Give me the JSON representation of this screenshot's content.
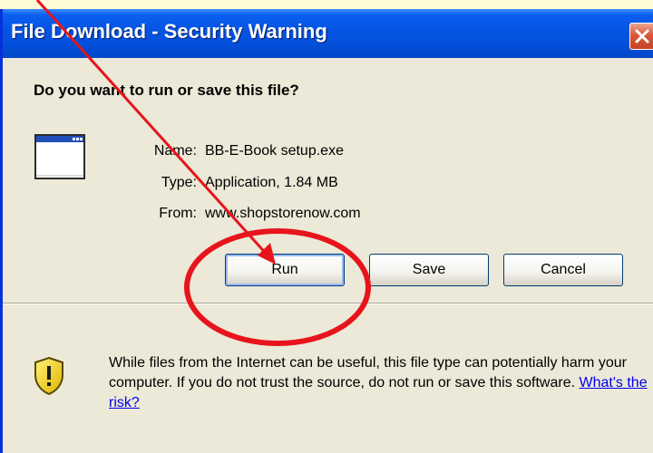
{
  "dialog": {
    "title": "File Download - Security Warning",
    "question": "Do you want to run or save this file?"
  },
  "file": {
    "name_label": "Name:",
    "name_value": "BB-E-Book setup.exe",
    "type_label": "Type:",
    "type_value": "Application, 1.84 MB",
    "from_label": "From:",
    "from_value": "www.shopstorenow.com"
  },
  "buttons": {
    "run": "Run",
    "save": "Save",
    "cancel": "Cancel"
  },
  "warning": {
    "text": "While files from the Internet can be useful, this file type can potentially harm your computer. If you do not trust the source, do not run or save this software.",
    "link": "What's the risk?"
  },
  "icons": {
    "close": "close-icon",
    "application": "application-icon",
    "shield": "security-shield-icon"
  },
  "colors": {
    "titlebar": "#0554e3",
    "dialog_bg": "#ece9d8",
    "annotation": "#e8141c",
    "link": "#0000ee"
  }
}
